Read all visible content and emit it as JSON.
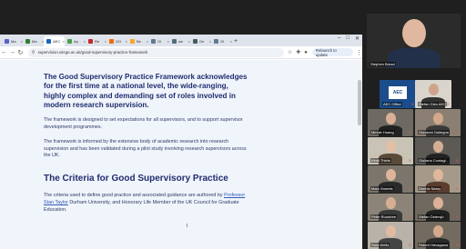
{
  "browser": {
    "tabs": [
      {
        "label": "Ma",
        "color": "#5b5fc7"
      },
      {
        "label": "Ma",
        "color": "#2e7d32"
      },
      {
        "label": "AEC",
        "color": "#1565c0",
        "active": true
      },
      {
        "label": "Ap",
        "color": "#43a047"
      },
      {
        "label": "Re",
        "color": "#c62828"
      },
      {
        "label": "GG",
        "color": "#ef6c00"
      },
      {
        "label": "Be",
        "color": "#f9a825"
      },
      {
        "label": "Gl",
        "color": "#607d8b"
      },
      {
        "label": "we",
        "color": "#546e7a"
      },
      {
        "label": "Ge",
        "color": "#455a64"
      },
      {
        "label": "Gl",
        "color": "#607d8b"
      }
    ],
    "url": "supervision.ukcge.ac.uk/good-supervisory-practice-framework",
    "update_button": "Relaunch to update",
    "new_tab": "+"
  },
  "article": {
    "lead": "The Good Supervisory Practice Framework acknowledges for the first time at a national level, the wide-ranging, highly complex and demanding set of roles involved in modern research supervision.",
    "para1": "The framework is designed to set expectations for all supervisors, and to support supervisor development programmes.",
    "para2": "The framework is informed by the extensive body of academic research into research supervision and has been validated during a pilot study involving research supervisors across the UK.",
    "section_title": "The Criteria for Good Supervisory Practice",
    "criteria_before": "The criteria used to define good practice and associated guidance are authored by ",
    "criteria_link": "Professor Stan Taylor",
    "criteria_after": " Durham University, and Honorary Life Member of the UK Council for Graduate Education."
  },
  "participants": [
    {
      "name": "Stephen Bread",
      "bg": "#2b2b2b",
      "skin": "#e0b8a0",
      "shirt": "#22304a"
    },
    {
      "name": "AEC Office",
      "bg": "#1b4d8c",
      "logo": "AEC"
    },
    {
      "name": "Stefan Gies AEC",
      "bg": "#d9d5cc",
      "skin": "#cfa48a",
      "shirt": "#333"
    },
    {
      "name": "Minnie Huang",
      "bg": "#6d6a63",
      "skin": "#d9b095",
      "shirt": "#222"
    },
    {
      "name": "Giovanni Gailegna",
      "bg": "#8a7f72",
      "skin": "#d2a88b",
      "shirt": "#3b3b3b"
    },
    {
      "name": "Kirsti Thiele",
      "bg": "#c9c3b6",
      "skin": "#e2bfa5",
      "shirt": "#5a4a3a"
    },
    {
      "name": "Giuliana Contagl...",
      "bg": "#5d5a56",
      "skin": "#d6ae93",
      "shirt": "#222"
    },
    {
      "name": "Marc Smeets",
      "bg": "#7b756c",
      "skin": "#dcb59a",
      "shirt": "#2a2a2a"
    },
    {
      "name": "Dennis Neary",
      "bg": "#a59a8a",
      "skin": "#e0b79b",
      "shirt": "#5b3d2e"
    },
    {
      "name": "Peter Rountree",
      "bg": "#8c8478",
      "skin": "#d8ae92",
      "shirt": "#3a3a3a"
    },
    {
      "name": "Stefan Östersjö",
      "bg": "#6f685f",
      "skin": "#dcb197",
      "shirt": "#222"
    },
    {
      "name": "Sara Wells",
      "bg": "#b8b2a8",
      "skin": "#e1bba0",
      "shirt": "#444"
    },
    {
      "name": "Robert Havagawa",
      "bg": "#736b60",
      "skin": "#d4a98c",
      "shirt": "#2a2a2a"
    }
  ]
}
